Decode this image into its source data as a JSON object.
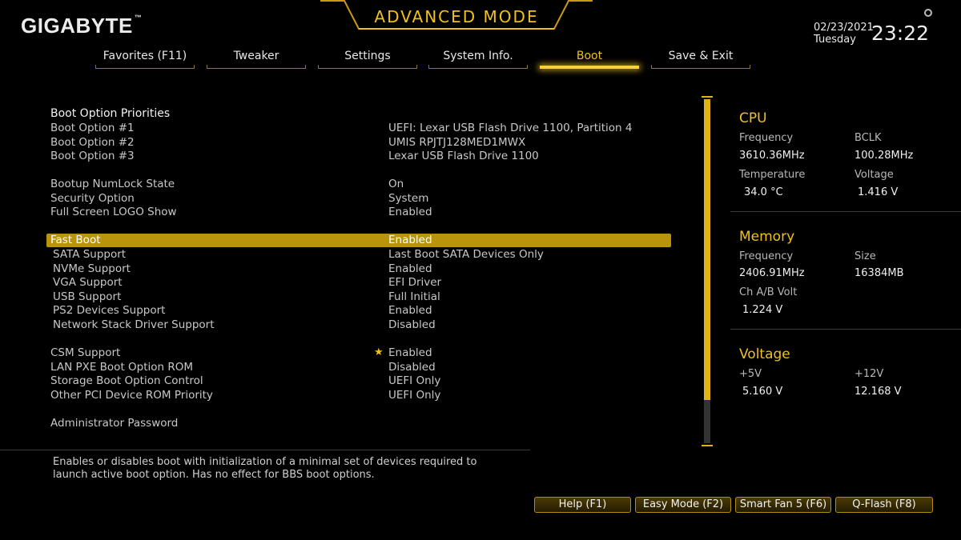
{
  "header": {
    "brand": "GIGABYTE",
    "brand_mark": "™",
    "mode_title": "ADVANCED MODE",
    "date": "02/23/2021",
    "day": "Tuesday",
    "time": "23:22"
  },
  "tabs": [
    {
      "label": "Favorites (F11)"
    },
    {
      "label": "Tweaker"
    },
    {
      "label": "Settings"
    },
    {
      "label": "System Info."
    },
    {
      "label": "Boot"
    },
    {
      "label": "Save & Exit"
    }
  ],
  "boot": {
    "section_title": "Boot Option Priorities",
    "rows": [
      {
        "label": "Boot Option #1",
        "value": "UEFI: Lexar USB Flash Drive 1100, Partition 4"
      },
      {
        "label": "Boot Option #2",
        "value": "UMIS RPJTJ128MED1MWX"
      },
      {
        "label": "Boot Option #3",
        "value": "Lexar USB Flash Drive 1100"
      },
      {
        "label": "Bootup NumLock State",
        "value": "On"
      },
      {
        "label": "Security Option",
        "value": "System"
      },
      {
        "label": "Full Screen LOGO Show",
        "value": "Enabled"
      },
      {
        "label": "Fast Boot",
        "value": "Enabled"
      },
      {
        "label": "SATA Support",
        "value": "Last Boot SATA Devices Only"
      },
      {
        "label": "NVMe Support",
        "value": "Enabled"
      },
      {
        "label": "VGA Support",
        "value": "EFI Driver"
      },
      {
        "label": "USB Support",
        "value": "Full Initial"
      },
      {
        "label": "PS2 Devices Support",
        "value": "Enabled"
      },
      {
        "label": "Network Stack Driver Support",
        "value": "Disabled"
      },
      {
        "label": "CSM Support",
        "value": "Enabled"
      },
      {
        "label": "LAN PXE Boot Option ROM",
        "value": "Disabled"
      },
      {
        "label": "Storage Boot Option Control",
        "value": "UEFI Only"
      },
      {
        "label": "Other PCI Device ROM Priority",
        "value": "UEFI Only"
      },
      {
        "label": "Administrator Password",
        "value": ""
      }
    ],
    "selected_index": 6
  },
  "help": {
    "text_line1": "Enables or disables boot with initialization of a minimal set of devices required to",
    "text_line2": "launch active boot option. Has no effect for BBS boot options."
  },
  "side": {
    "cpu": {
      "title": "CPU",
      "freq_label": "Frequency",
      "freq_value": "3610.36MHz",
      "bclk_label": "BCLK",
      "bclk_value": "100.28MHz",
      "temp_label": "Temperature",
      "temp_value": "34.0 °C",
      "volt_label": "Voltage",
      "volt_value": "1.416 V"
    },
    "memory": {
      "title": "Memory",
      "freq_label": "Frequency",
      "freq_value": "2406.91MHz",
      "size_label": "Size",
      "size_value": "16384MB",
      "volt_label": "Ch A/B Volt",
      "volt_value": "1.224 V"
    },
    "voltage": {
      "title": "Voltage",
      "v5_label": "+5V",
      "v5_value": "5.160 V",
      "v12_label": "+12V",
      "v12_value": "12.168 V"
    }
  },
  "footer": {
    "help": "Help (F1)",
    "easy": "Easy Mode (F2)",
    "fan": "Smart Fan 5 (F6)",
    "qflash": "Q-Flash (F8)"
  },
  "colors": {
    "accent": "#f0c11a",
    "selection": "#b8950a",
    "background": "#000000"
  }
}
